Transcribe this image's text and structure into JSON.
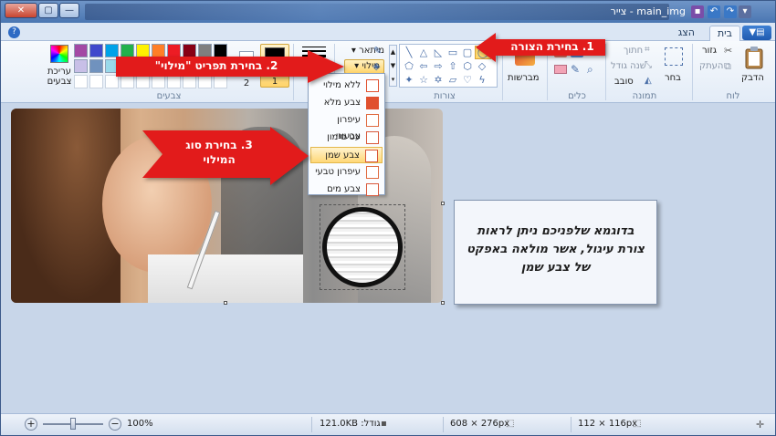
{
  "window": {
    "title": "main_img - צייר",
    "controls": {
      "close": "✕",
      "maximize": "▢",
      "minimize": "—"
    },
    "quick_access_icons": [
      "save-icon",
      "undo-icon",
      "redo-icon",
      "dropdown-icon"
    ]
  },
  "tabs": {
    "home": "בית",
    "view": "הצג",
    "app_menu": "▼▤",
    "help": "?"
  },
  "ribbon": {
    "clipboard": {
      "group": "לוח",
      "paste": "הדבק",
      "cut": "גזור",
      "copy": "העתק"
    },
    "image": {
      "group": "תמונה",
      "select": "בחר",
      "crop": "חתוך",
      "resize": "שנה גודל",
      "rotate": "סובב"
    },
    "tools": {
      "group": "כלים"
    },
    "brushes": {
      "label": "מברשות"
    },
    "shapes": {
      "group": "צורות",
      "outline": "מיתאר",
      "fill": "מילוי"
    },
    "size": {
      "label": "גודל"
    },
    "colors": {
      "group": "צבעים",
      "color1_label": "1",
      "color2_label": "2",
      "edit_colors": "עריכת צבעים",
      "palette": [
        "#000000",
        "#7f7f7f",
        "#880015",
        "#ed1c24",
        "#ff7f27",
        "#fff200",
        "#22b14c",
        "#00a2e8",
        "#3f48cc",
        "#a349a4",
        "#ffffff",
        "#c3c3c3",
        "#b97a57",
        "#ffaec9",
        "#ffc90e",
        "#efe4b0",
        "#b5e61d",
        "#99d9ea",
        "#7092be",
        "#c8bfe7"
      ]
    }
  },
  "fill_menu": {
    "items": [
      {
        "label": "ללא מילוי",
        "icon": "no-fill-icon"
      },
      {
        "label": "צבע מלא",
        "icon": "solid-color-icon"
      },
      {
        "label": "עיפרון צבעוני",
        "icon": "crayon-icon"
      },
      {
        "label": "עט סימון",
        "icon": "marker-icon"
      },
      {
        "label": "צבע שמן",
        "icon": "oil-paint-icon",
        "selected": true
      },
      {
        "label": "עיפרון טבעי",
        "icon": "natural-pencil-icon"
      },
      {
        "label": "צבע מים",
        "icon": "watercolor-icon"
      }
    ]
  },
  "callouts": {
    "step1": "1. בחירת הצורה",
    "step2": "2. בחירת תפריט \"מילוי\"",
    "step3_line1": "3. בחירת סוג",
    "step3_line2": "המילוי"
  },
  "note": {
    "line1": "בדוגמא שלפניכם ניתן לראות",
    "line2": "צורת עיגול, אשר מולאה באפקט",
    "line3": "של צבע שמן"
  },
  "statusbar": {
    "selection_size": "112 × 116px",
    "image_size": "608 × 276px",
    "file_size": "121.0KB :גודל",
    "zoom": "100%"
  },
  "colors": {
    "callout_red": "#e21b1b",
    "selected_item": "#ffd877"
  }
}
